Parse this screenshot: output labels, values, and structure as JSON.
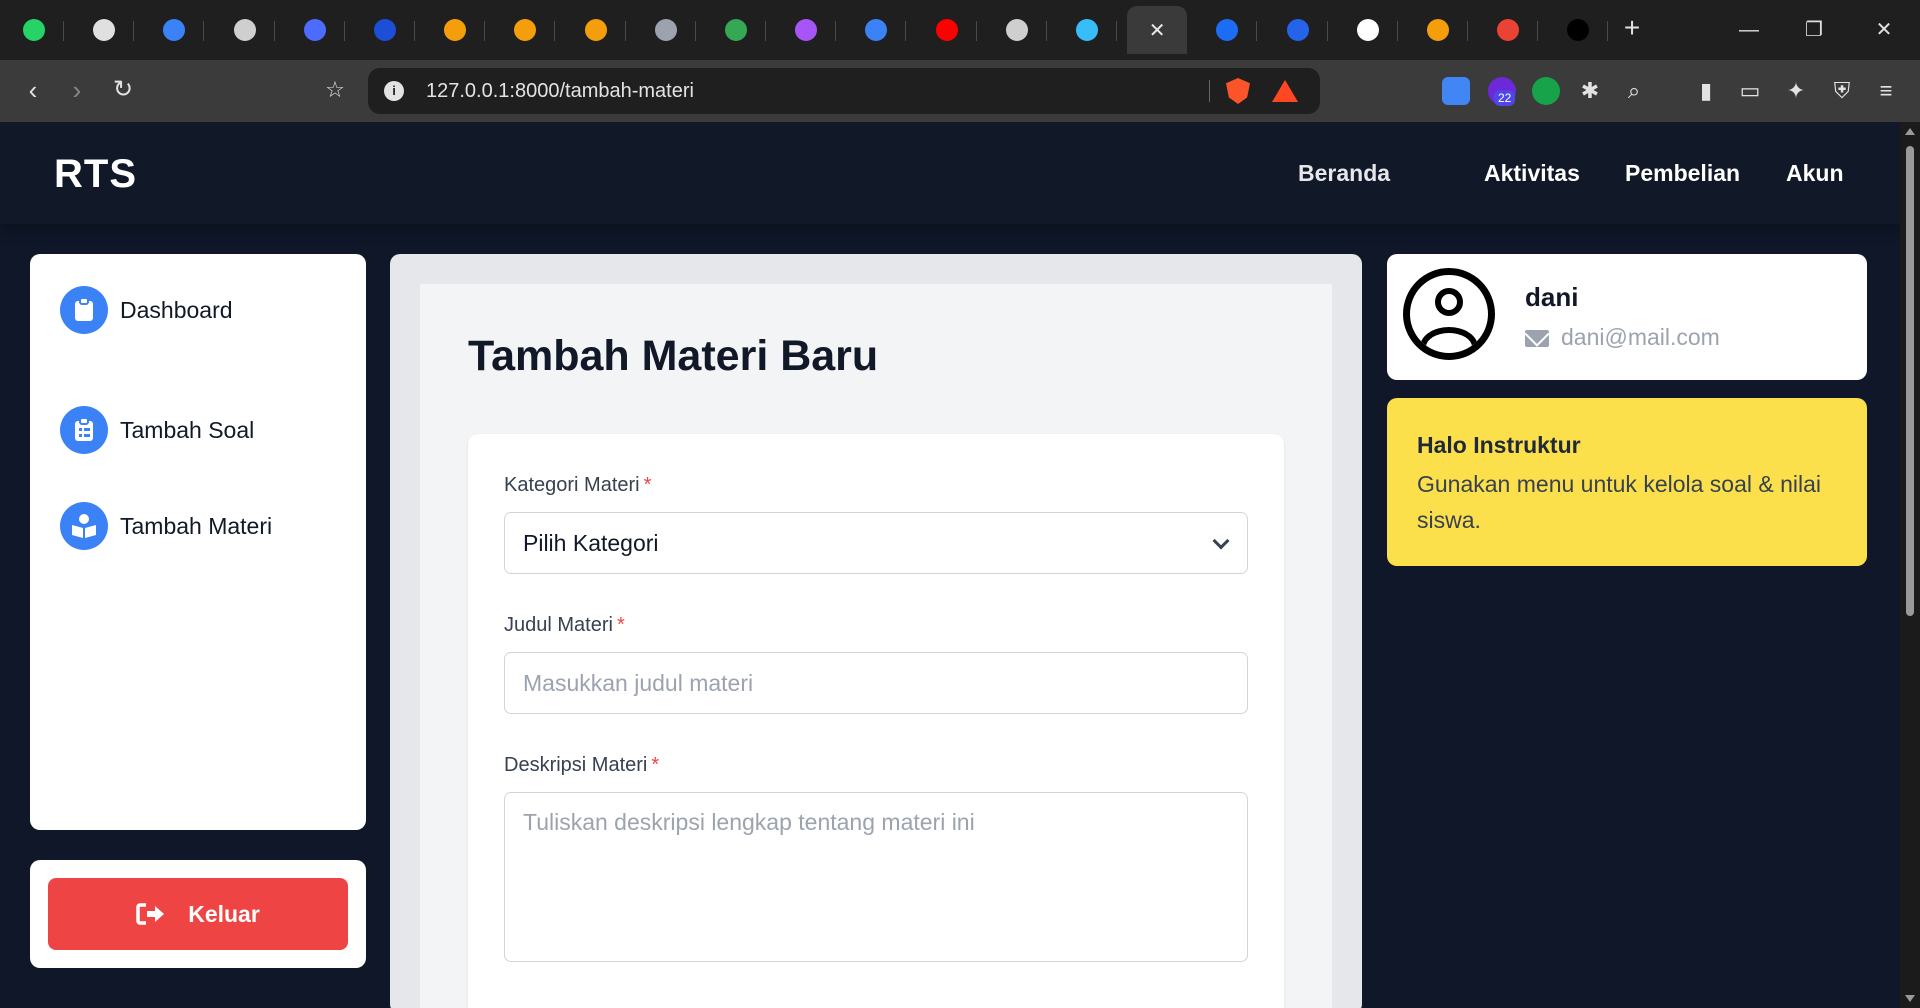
{
  "browser": {
    "tabs": [
      {
        "icon": "whatsapp-icon",
        "color": "#25d366"
      },
      {
        "icon": "openai-icon",
        "color": "#e0e0e0"
      },
      {
        "icon": "feather-icon",
        "color": "#3b82f6"
      },
      {
        "icon": "globe-icon",
        "color": "#cfcfcf"
      },
      {
        "icon": "deepseek-icon",
        "color": "#4d6bfe"
      },
      {
        "icon": "shield-icon",
        "color": "#1d4ed8"
      },
      {
        "icon": "infinity-icon",
        "color": "#f59e0b"
      },
      {
        "icon": "infinity-icon",
        "color": "#f59e0b"
      },
      {
        "icon": "infinity-icon",
        "color": "#f59e0b"
      },
      {
        "icon": "circle-logo-icon",
        "color": "#9ca3af"
      },
      {
        "icon": "drive-icon",
        "color": "#34a853"
      },
      {
        "icon": "chat-bubble-icon",
        "color": "#a855f7"
      },
      {
        "icon": "graduation-cap-icon",
        "color": "#3b82f6"
      },
      {
        "icon": "youtube-icon",
        "color": "#ff0000"
      },
      {
        "icon": "globe-icon",
        "color": "#cfcfcf"
      },
      {
        "icon": "tailwind-icon",
        "color": "#38bdf8"
      },
      {
        "icon": "close-icon",
        "color": "#e8e8e8",
        "active": true
      },
      {
        "icon": "circle-p-icon",
        "color": "#1d6cf5"
      },
      {
        "icon": "flag-icon",
        "color": "#2563eb"
      },
      {
        "icon": "rg-icon",
        "color": "#ffffff"
      },
      {
        "icon": "mountain-icon",
        "color": "#f59e0b"
      },
      {
        "icon": "google-icon",
        "color": "#ea4335"
      },
      {
        "icon": "medium-icon",
        "color": "#000000"
      }
    ],
    "url": "127.0.0.1:8000/tambah-materi",
    "extension_badge": "22"
  },
  "navbar": {
    "brand": "RTS",
    "links": [
      "Beranda",
      "Aktivitas",
      "Pembelian",
      "Akun"
    ]
  },
  "sidebar": {
    "items": [
      {
        "label": "Dashboard",
        "icon": "clipboard-icon"
      },
      {
        "label": "Tambah Soal",
        "icon": "clipboard-list-icon"
      },
      {
        "label": "Tambah Materi",
        "icon": "book-reader-icon"
      }
    ],
    "logout_label": "Keluar"
  },
  "form": {
    "title": "Tambah Materi Baru",
    "category_label": "Kategori Materi",
    "category_value": "Pilih Kategori",
    "title_label": "Judul Materi",
    "title_placeholder": "Masukkan judul materi",
    "desc_label": "Deskripsi Materi",
    "desc_placeholder": "Tuliskan deskripsi lengkap tentang materi ini",
    "required_mark": "*"
  },
  "profile": {
    "name": "dani",
    "email": "dani@mail.com"
  },
  "greeting": {
    "title": "Halo Instruktur",
    "text": "Gunakan menu untuk kelola soal & nilai siswa."
  },
  "colors": {
    "primary": "#3b82f6",
    "danger": "#ef4444",
    "highlight": "#fbe04b",
    "navbar": "#111827"
  }
}
